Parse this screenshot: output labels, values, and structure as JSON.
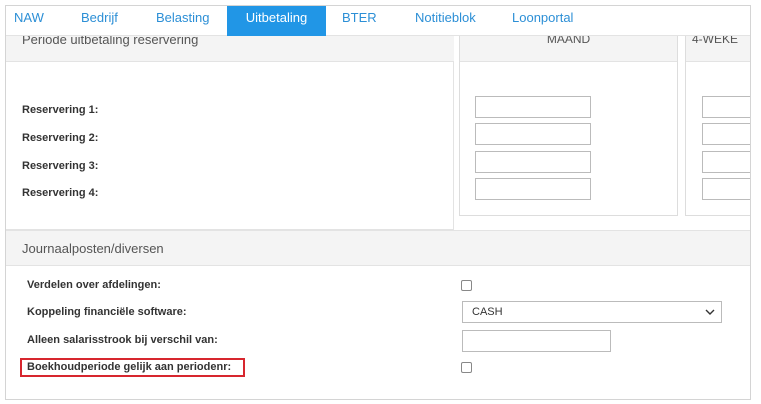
{
  "tabs": [
    {
      "label": "NAW"
    },
    {
      "label": "Bedrijf"
    },
    {
      "label": "Belasting"
    },
    {
      "label": "Uitbetaling",
      "active": true
    },
    {
      "label": "BTER"
    },
    {
      "label": "Notitieblok"
    },
    {
      "label": "Loonportal"
    }
  ],
  "reservering": {
    "section_title": "Periode uitbetaling reservering",
    "rows": [
      {
        "label": "Reservering 1:"
      },
      {
        "label": "Reservering 2:"
      },
      {
        "label": "Reservering 3:"
      },
      {
        "label": "Reservering 4:"
      }
    ],
    "columns": [
      {
        "title": "MAAND"
      },
      {
        "title": "4-WEKE"
      }
    ]
  },
  "journaal": {
    "section_title": "Journaalposten/diversen",
    "verdelen_label": "Verdelen over afdelingen:",
    "verdelen_checked": false,
    "koppeling_label": "Koppeling financiële software:",
    "koppeling_value": "CASH",
    "alleen_label": "Alleen salarisstrook bij verschil van:",
    "alleen_value": "",
    "boekhoud_label": "Boekhoudperiode gelijk aan periodenr:",
    "boekhoud_checked": false
  },
  "colors": {
    "tab_active_bg": "#2196e6",
    "tab_text": "#2c8fd6",
    "highlight_border": "#d7262e"
  }
}
